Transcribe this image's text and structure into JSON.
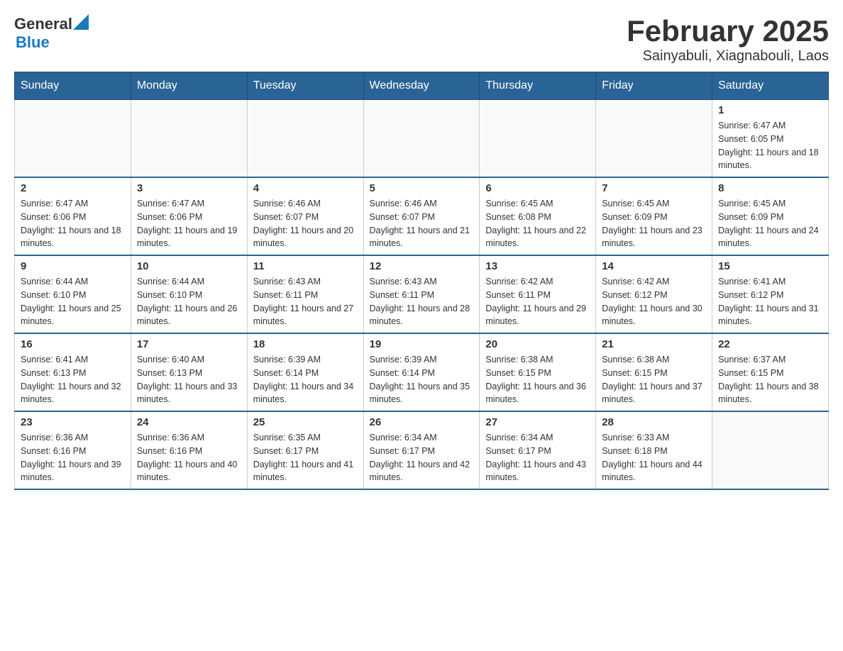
{
  "header": {
    "title": "February 2025",
    "subtitle": "Sainyabuli, Xiagnabouli, Laos",
    "logo_general": "General",
    "logo_blue": "Blue"
  },
  "days_of_week": [
    "Sunday",
    "Monday",
    "Tuesday",
    "Wednesday",
    "Thursday",
    "Friday",
    "Saturday"
  ],
  "weeks": [
    [
      {
        "day": "",
        "info": ""
      },
      {
        "day": "",
        "info": ""
      },
      {
        "day": "",
        "info": ""
      },
      {
        "day": "",
        "info": ""
      },
      {
        "day": "",
        "info": ""
      },
      {
        "day": "",
        "info": ""
      },
      {
        "day": "1",
        "info": "Sunrise: 6:47 AM\nSunset: 6:05 PM\nDaylight: 11 hours and 18 minutes."
      }
    ],
    [
      {
        "day": "2",
        "info": "Sunrise: 6:47 AM\nSunset: 6:06 PM\nDaylight: 11 hours and 18 minutes."
      },
      {
        "day": "3",
        "info": "Sunrise: 6:47 AM\nSunset: 6:06 PM\nDaylight: 11 hours and 19 minutes."
      },
      {
        "day": "4",
        "info": "Sunrise: 6:46 AM\nSunset: 6:07 PM\nDaylight: 11 hours and 20 minutes."
      },
      {
        "day": "5",
        "info": "Sunrise: 6:46 AM\nSunset: 6:07 PM\nDaylight: 11 hours and 21 minutes."
      },
      {
        "day": "6",
        "info": "Sunrise: 6:45 AM\nSunset: 6:08 PM\nDaylight: 11 hours and 22 minutes."
      },
      {
        "day": "7",
        "info": "Sunrise: 6:45 AM\nSunset: 6:09 PM\nDaylight: 11 hours and 23 minutes."
      },
      {
        "day": "8",
        "info": "Sunrise: 6:45 AM\nSunset: 6:09 PM\nDaylight: 11 hours and 24 minutes."
      }
    ],
    [
      {
        "day": "9",
        "info": "Sunrise: 6:44 AM\nSunset: 6:10 PM\nDaylight: 11 hours and 25 minutes."
      },
      {
        "day": "10",
        "info": "Sunrise: 6:44 AM\nSunset: 6:10 PM\nDaylight: 11 hours and 26 minutes."
      },
      {
        "day": "11",
        "info": "Sunrise: 6:43 AM\nSunset: 6:11 PM\nDaylight: 11 hours and 27 minutes."
      },
      {
        "day": "12",
        "info": "Sunrise: 6:43 AM\nSunset: 6:11 PM\nDaylight: 11 hours and 28 minutes."
      },
      {
        "day": "13",
        "info": "Sunrise: 6:42 AM\nSunset: 6:11 PM\nDaylight: 11 hours and 29 minutes."
      },
      {
        "day": "14",
        "info": "Sunrise: 6:42 AM\nSunset: 6:12 PM\nDaylight: 11 hours and 30 minutes."
      },
      {
        "day": "15",
        "info": "Sunrise: 6:41 AM\nSunset: 6:12 PM\nDaylight: 11 hours and 31 minutes."
      }
    ],
    [
      {
        "day": "16",
        "info": "Sunrise: 6:41 AM\nSunset: 6:13 PM\nDaylight: 11 hours and 32 minutes."
      },
      {
        "day": "17",
        "info": "Sunrise: 6:40 AM\nSunset: 6:13 PM\nDaylight: 11 hours and 33 minutes."
      },
      {
        "day": "18",
        "info": "Sunrise: 6:39 AM\nSunset: 6:14 PM\nDaylight: 11 hours and 34 minutes."
      },
      {
        "day": "19",
        "info": "Sunrise: 6:39 AM\nSunset: 6:14 PM\nDaylight: 11 hours and 35 minutes."
      },
      {
        "day": "20",
        "info": "Sunrise: 6:38 AM\nSunset: 6:15 PM\nDaylight: 11 hours and 36 minutes."
      },
      {
        "day": "21",
        "info": "Sunrise: 6:38 AM\nSunset: 6:15 PM\nDaylight: 11 hours and 37 minutes."
      },
      {
        "day": "22",
        "info": "Sunrise: 6:37 AM\nSunset: 6:15 PM\nDaylight: 11 hours and 38 minutes."
      }
    ],
    [
      {
        "day": "23",
        "info": "Sunrise: 6:36 AM\nSunset: 6:16 PM\nDaylight: 11 hours and 39 minutes."
      },
      {
        "day": "24",
        "info": "Sunrise: 6:36 AM\nSunset: 6:16 PM\nDaylight: 11 hours and 40 minutes."
      },
      {
        "day": "25",
        "info": "Sunrise: 6:35 AM\nSunset: 6:17 PM\nDaylight: 11 hours and 41 minutes."
      },
      {
        "day": "26",
        "info": "Sunrise: 6:34 AM\nSunset: 6:17 PM\nDaylight: 11 hours and 42 minutes."
      },
      {
        "day": "27",
        "info": "Sunrise: 6:34 AM\nSunset: 6:17 PM\nDaylight: 11 hours and 43 minutes."
      },
      {
        "day": "28",
        "info": "Sunrise: 6:33 AM\nSunset: 6:18 PM\nDaylight: 11 hours and 44 minutes."
      },
      {
        "day": "",
        "info": ""
      }
    ]
  ]
}
